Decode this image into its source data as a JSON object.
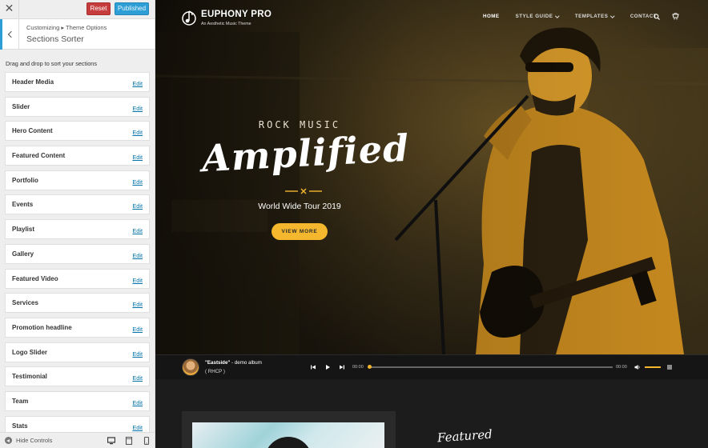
{
  "customizer": {
    "close_icon": "close-icon",
    "reset_label": "Reset",
    "publish_label": "Published",
    "breadcrumb": "Customizing ▸ Theme Options",
    "title": "Sections Sorter",
    "hint": "Drag and drop to sort your sections",
    "edit_label": "Edit",
    "sections": [
      "Header Media",
      "Slider",
      "Hero Content",
      "Featured Content",
      "Portfolio",
      "Events",
      "Playlist",
      "Gallery",
      "Featured Video",
      "Services",
      "Promotion headline",
      "Logo Slider",
      "Testimonial",
      "Team",
      "Stats"
    ],
    "footer": {
      "hide_controls": "Hide Controls"
    }
  },
  "site": {
    "brand": {
      "name": "EUPHONY PRO",
      "tagline": "An Aesthetic Music Theme"
    },
    "nav": [
      "HOME",
      "STYLE GUIDE",
      "TEMPLATES",
      "CONTACT"
    ],
    "hero": {
      "kicker": "ROCK MUSIC",
      "headline": "Amplified",
      "subtitle": "World Wide Tour 2019",
      "cta": "VIEW MORE"
    },
    "player": {
      "track_title": "\"Eastside\"",
      "track_suffix": " - demo album",
      "artist": "( RHCP )",
      "current_time": "00:00",
      "duration": "00:00"
    },
    "featured_heading": "Featured"
  },
  "colors": {
    "accent": "#f5b72e",
    "publish": "#2e9fd6",
    "reset": "#c63b3b",
    "link": "#0073aa"
  }
}
